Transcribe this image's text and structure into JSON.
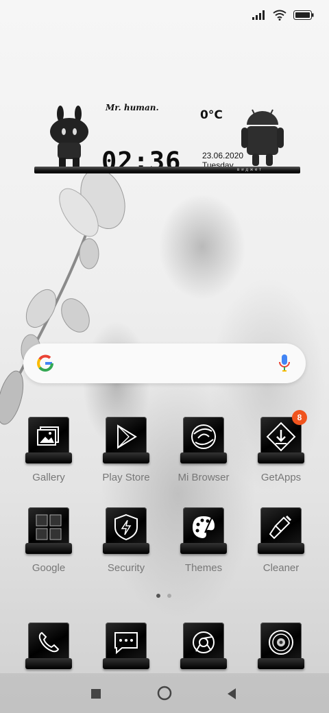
{
  "status_bar": {
    "icons": [
      "signal-icon",
      "wifi-icon",
      "battery-icon"
    ]
  },
  "widget": {
    "author": "Mr. human.",
    "temperature": "0°C",
    "time": "02:36",
    "date": "23.06.2020",
    "day": "Tuesday",
    "shelf_label": "виджет"
  },
  "search": {
    "icons": [
      "google-g-icon",
      "microphone-icon"
    ]
  },
  "apps": [
    {
      "label": "Gallery",
      "icon": "gallery-icon"
    },
    {
      "label": "Play Store",
      "icon": "play-store-icon"
    },
    {
      "label": "Mi Browser",
      "icon": "browser-icon"
    },
    {
      "label": "GetApps",
      "icon": "getapps-icon",
      "badge": "8"
    },
    {
      "label": "Google",
      "icon": "google-folder-icon"
    },
    {
      "label": "Security",
      "icon": "security-icon"
    },
    {
      "label": "Themes",
      "icon": "themes-icon"
    },
    {
      "label": "Cleaner",
      "icon": "cleaner-icon"
    }
  ],
  "dock": [
    {
      "icon": "phone-icon"
    },
    {
      "icon": "messages-icon"
    },
    {
      "icon": "chrome-icon"
    },
    {
      "icon": "camera-icon"
    }
  ],
  "page_indicator": {
    "pages": 2,
    "current": 1
  },
  "navbar": {
    "buttons": [
      "recents-button",
      "home-button",
      "back-button"
    ]
  }
}
